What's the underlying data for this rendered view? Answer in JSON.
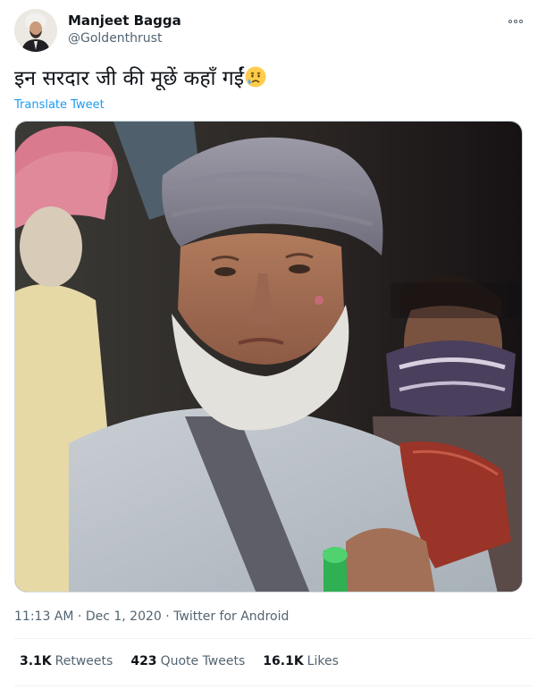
{
  "author": {
    "name": "Manjeet Bagga",
    "handle": "@Goldenthrust"
  },
  "tweet": {
    "text": "इन सरदार जी की मूछें कहाँ गईं",
    "emoji": "crying-face-emoji",
    "translate_label": "Translate Tweet",
    "time": "11:13 AM",
    "separator": "·",
    "date": "Dec 1, 2020",
    "source": "Twitter for Android"
  },
  "stats": {
    "retweets_count": "3.1K",
    "retweets_label": "Retweets",
    "quotes_count": "423",
    "quotes_label": "Quote Tweets",
    "likes_count": "16.1K",
    "likes_label": "Likes"
  },
  "icons": {
    "more": "more-options-icon"
  },
  "colors": {
    "link": "#1d9bf0",
    "secondary_text": "#536471",
    "primary_text": "#0f1419",
    "border": "#cfd9de"
  }
}
